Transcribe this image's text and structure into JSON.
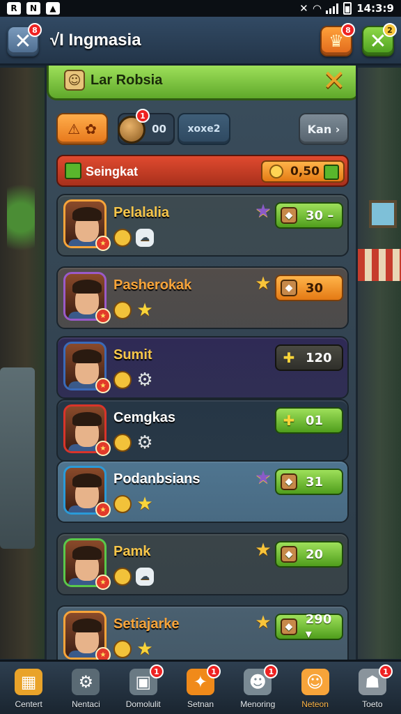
{
  "status_bar": {
    "time": "14:3:9",
    "notification_icons": [
      "R",
      "N",
      "image-icon"
    ]
  },
  "header": {
    "title": "√I Ingmasia",
    "close_badge": "8",
    "trophy_badge": "8",
    "check_badge": "2"
  },
  "banner": {
    "label": "Lar Robsia"
  },
  "tabs": [
    {
      "label": "⚠ ✿"
    },
    {
      "label": "00",
      "badge": "1"
    },
    {
      "label": "xoxe2"
    },
    {
      "label": "Kan ›"
    }
  ],
  "summary": {
    "label": "Seingkat",
    "value": "0,50"
  },
  "rows": [
    {
      "name": "Pelalalia",
      "value": "30 –",
      "pill": "green",
      "star": "purple",
      "name_color": "#f7c64a",
      "bg": "#3d4a50",
      "frame": "#f7a43a",
      "badge2": "ghost"
    },
    {
      "name": "Pasherokak",
      "value": "30",
      "pill": "orange",
      "star": "gold",
      "name_color": "#f7a43a",
      "bg": "#524c49",
      "frame": "#9a5ac8",
      "badge2": "star"
    },
    {
      "name": "Sumit",
      "value": "120",
      "pill": "dark",
      "star": "",
      "name_color": "#f7c64a",
      "bg": "#2f2a55",
      "frame": "#3a6ab8",
      "badge2": "gear"
    },
    {
      "name": "Cemgkas",
      "value": "01",
      "pill": "green",
      "star": "",
      "name_color": "#ffffff",
      "bg": "#263645",
      "frame": "#d9342a",
      "badge2": "gear"
    },
    {
      "name": "Podanbsians",
      "value": "31",
      "pill": "green",
      "star": "purple",
      "name_color": "#ffffff",
      "bg": "#4f7590",
      "frame": "#2a9ad8",
      "badge2": "star"
    },
    {
      "name": "Pamk",
      "value": "20",
      "pill": "green",
      "star": "gold",
      "name_color": "#f7c64a",
      "bg": "#3a4448",
      "frame": "#5ac84a",
      "badge2": "ghost"
    },
    {
      "name": "Setiajarke",
      "value": "290 ▾",
      "pill": "green",
      "star": "gold",
      "name_color": "#f7a43a",
      "bg": "#4a6070",
      "frame": "#f7a43a",
      "badge2": "star"
    }
  ],
  "nav": [
    {
      "label": "Centert",
      "icon": "chest-icon",
      "glyph": "▦",
      "bg": "#e9a32a"
    },
    {
      "label": "Nentaci",
      "icon": "gear-icon",
      "glyph": "⚙",
      "bg": "#5a6a74"
    },
    {
      "label": "Domolulit",
      "icon": "jar-icon",
      "glyph": "▣",
      "bg": "#6a7a84",
      "badge": "1"
    },
    {
      "label": "Setnan",
      "icon": "treasure-icon",
      "glyph": "✦",
      "bg": "#f08a1a",
      "badge": "1"
    },
    {
      "label": "Menoring",
      "icon": "robot-icon",
      "glyph": "☻",
      "bg": "#7a8a94",
      "badge": "1"
    },
    {
      "label": "Neteon",
      "icon": "smiley-icon",
      "glyph": "☺",
      "bg": "#f7a43a",
      "active": true
    },
    {
      "label": "Toeto",
      "icon": "helmet-icon",
      "glyph": "☗",
      "bg": "#8a949c",
      "badge": "1"
    }
  ]
}
